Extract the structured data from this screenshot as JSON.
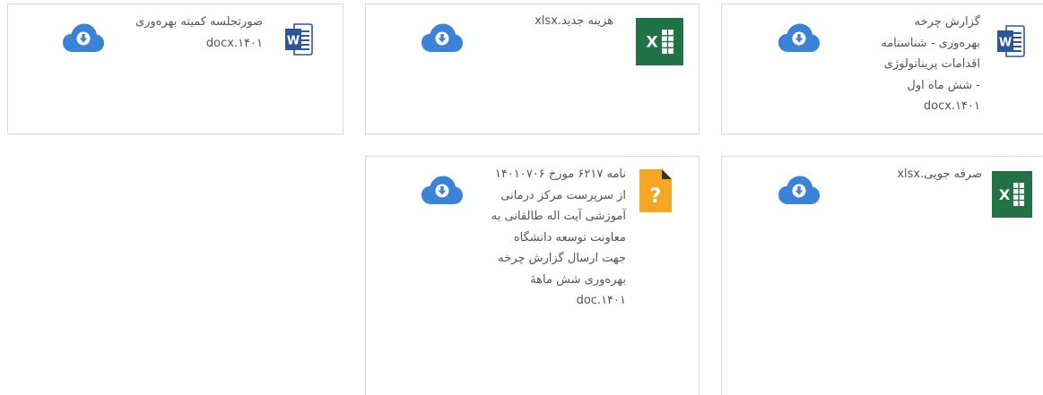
{
  "files": [
    {
      "name": "گزارش چرخه بهرەوری - شناسنامه اقدامات پریناتولوژی - شش ماه اول ۱۴۰۱.docx",
      "type": "word",
      "icon": "word-file-icon"
    },
    {
      "name": "هزینه جدید.xlsx",
      "type": "excel",
      "icon": "excel-file-icon"
    },
    {
      "name": "صورتجلسه کمیته بهرەوری ۱۴۰۱.docx",
      "type": "word",
      "icon": "word-file-icon"
    },
    {
      "name": "صرفه جویی.xlsx",
      "type": "excel",
      "icon": "excel-file-icon"
    },
    {
      "name": "نامه ۶۲۱۷ مورخ ۱۴۰۱۰۷۰۶ از سرپرست مرکز درمانی آموزشی آیت اله طالقانی به معاونت توسعه دانشگاه جهت ارسال گزارش چرخه بهرەوری شش ماهۀ ۱۴۰۱.doc",
      "type": "unknown",
      "icon": "unknown-file-icon"
    }
  ],
  "colors": {
    "word_blue": "#2b579a",
    "excel_green": "#217346",
    "unknown_orange": "#f5a623",
    "cloud_blue": "#3b82d9"
  }
}
